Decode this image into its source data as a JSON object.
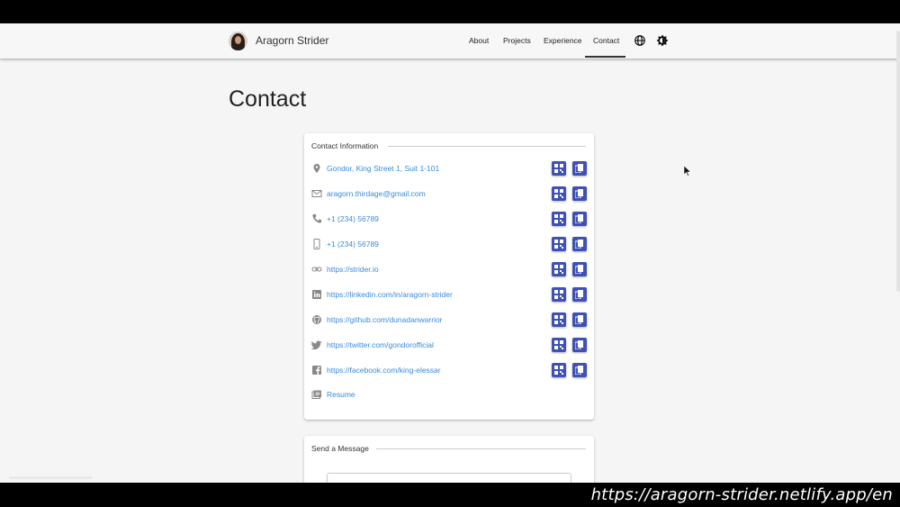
{
  "nav": {
    "brand": "Aragorn Strider",
    "links": [
      "About",
      "Projects",
      "Experience",
      "Contact"
    ],
    "active": "Contact",
    "icons": [
      "globe-icon",
      "theme-toggle-icon"
    ]
  },
  "page": {
    "title": "Contact"
  },
  "contact_card": {
    "header": "Contact Information",
    "items": [
      {
        "icon": "location-icon",
        "text": "Gondor, King Street 1, Suit 1-101",
        "has_actions": true
      },
      {
        "icon": "email-icon",
        "text": "aragorn.thirdage@gmail.com",
        "has_actions": true
      },
      {
        "icon": "phone-icon",
        "text": "+1 (234) 56789",
        "has_actions": true
      },
      {
        "icon": "mobile-icon",
        "text": "+1 (234) 56789",
        "has_actions": true
      },
      {
        "icon": "link-icon",
        "text": "https://strider.io",
        "has_actions": true
      },
      {
        "icon": "linkedin-icon",
        "text": "https://linkedin.com/in/aragorn-strider",
        "has_actions": true
      },
      {
        "icon": "github-icon",
        "text": "https://github.com/dunadanwarrior",
        "has_actions": true
      },
      {
        "icon": "twitter-icon",
        "text": "https://twitter.com/gondorofficial",
        "has_actions": true
      },
      {
        "icon": "facebook-icon",
        "text": "https://facebook.com/king-elessar",
        "has_actions": true
      },
      {
        "icon": "resume-icon",
        "text": "Resume",
        "has_actions": false
      }
    ],
    "action_icons": [
      "qr-code-icon",
      "copy-icon"
    ]
  },
  "message_card": {
    "header": "Send a Message"
  },
  "caption": {
    "url": "https://aragorn-strider.netlify.app/en"
  },
  "colors": {
    "accent": "#3f51b5",
    "link": "#3a8bd6",
    "background": "#f5f5f5"
  }
}
